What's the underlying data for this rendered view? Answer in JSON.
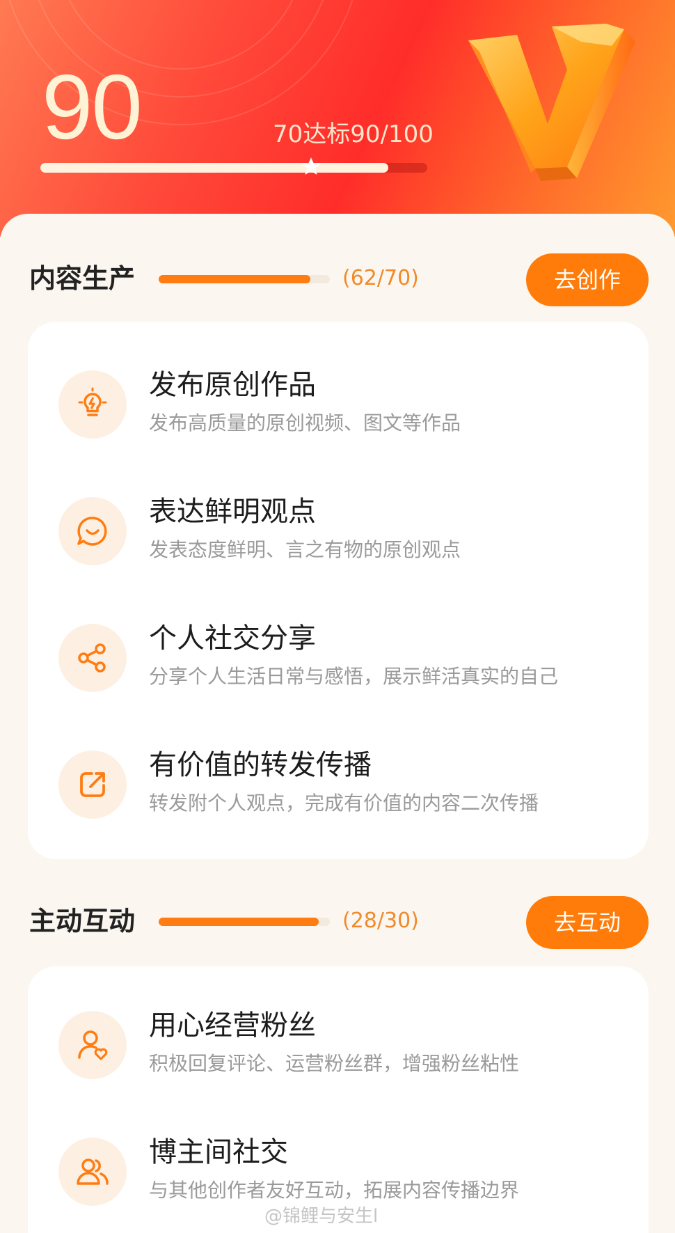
{
  "hero": {
    "score": "90",
    "target_text": "70达标90/100",
    "progress": 0.9,
    "star_position_fraction": 0.7
  },
  "sections": [
    {
      "title": "内容生产",
      "count_text": "(62/70)",
      "progress": 0.886,
      "button_label": "去创作",
      "items": [
        {
          "icon": "lightbulb-icon",
          "title": "发布原创作品",
          "desc": "发布高质量的原创视频、图文等作品"
        },
        {
          "icon": "smile-chat-icon",
          "title": "表达鲜明观点",
          "desc": "发表态度鲜明、言之有物的原创观点"
        },
        {
          "icon": "share-icon",
          "title": "个人社交分享",
          "desc": "分享个人生活日常与感悟，展示鲜活真实的自己"
        },
        {
          "icon": "forward-icon",
          "title": "有价值的转发传播",
          "desc": "转发附个人观点，完成有价值的内容二次传播"
        }
      ]
    },
    {
      "title": "主动互动",
      "count_text": "(28/30)",
      "progress": 0.933,
      "button_label": "去互动",
      "items": [
        {
          "icon": "user-heart-icon",
          "title": "用心经营粉丝",
          "desc": "积极回复评论、运营粉丝群，增强粉丝粘性"
        },
        {
          "icon": "users-icon",
          "title": "博主间社交",
          "desc": "与其他创作者友好互动，拓展内容传播边界"
        }
      ]
    }
  ],
  "watermark": "@锦鲤与安生l",
  "colors": {
    "accent": "#ff7c0a",
    "hero_red": "#ff2d2a",
    "icon_bg": "#fdf0e2"
  }
}
